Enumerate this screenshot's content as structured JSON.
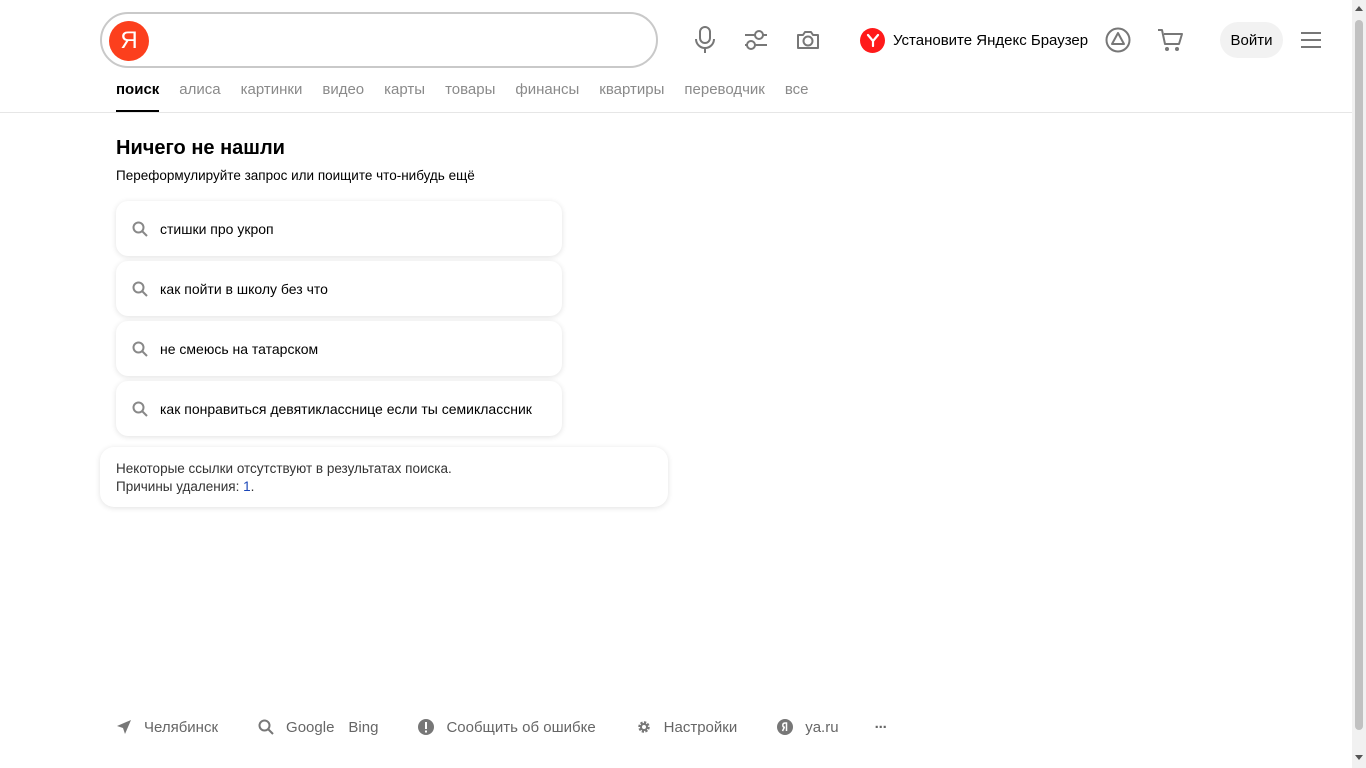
{
  "header": {
    "logo_letter": "Я",
    "search_value": "",
    "promo_text": "Установите Яндекс Браузер",
    "login_label": "Войти"
  },
  "tabs": [
    "поиск",
    "алиса",
    "картинки",
    "видео",
    "карты",
    "товары",
    "финансы",
    "квартиры",
    "переводчик",
    "все"
  ],
  "main": {
    "title": "Ничего не нашли",
    "subtitle": "Переформулируйте запрос или поищите что-нибудь ещё",
    "suggestions": [
      "стишки про укроп",
      "как пойти в школу без что",
      "не смеюсь на татарском",
      "как понравиться девятикласснице если ты семиклассник"
    ],
    "notice_line1": "Некоторые ссылки отсутствуют в результатах поиска.",
    "notice_line2_prefix": "Причины удаления: ",
    "notice_link": "1",
    "notice_suffix": "."
  },
  "footer": {
    "city": "Челябинск",
    "google": "Google",
    "bing": "Bing",
    "report": "Сообщить об ошибке",
    "settings": "Настройки",
    "yaru": "ya.ru",
    "more": "···"
  },
  "colors": {
    "brand": "#fc3f1d",
    "browser_promo": "#ff1a1a",
    "link": "#1a46b8"
  }
}
